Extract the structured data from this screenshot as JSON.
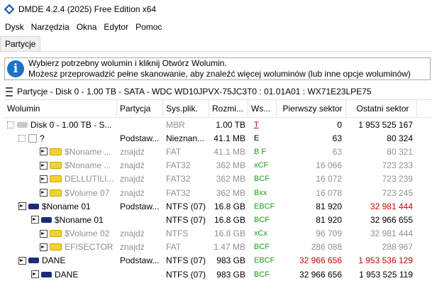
{
  "window": {
    "title": "DMDE 4.2.4 (2025) Free Edition x64"
  },
  "menu": [
    "Dysk",
    "Narzędzia",
    "Okna",
    "Edytor",
    "Pomoc"
  ],
  "tabs": [
    "Partycje"
  ],
  "info": {
    "line1": "Wybierz potrzebny wolumin i kliknij Otwórz Wolumin.",
    "line2": "Możesz przeprowadzić pełne skanowanie, aby znaleźć więcej woluminów (lub inne opcje woluminów)"
  },
  "panel": {
    "title": "Partycje - Disk 0 - 1.00 TB - SATA - WDC WD10JPVX-75JC3T0 : 01.01A01 : WX71E23LPE75"
  },
  "columns": [
    "Wolumin",
    "Partycja",
    "Sys.plik.",
    "Rozmi...",
    "Ws...",
    "Pierwszy sektor",
    "Ostatni sektor"
  ],
  "rows": [
    {
      "name": "Disk 0 - 1.00 TB - S...",
      "partition": "",
      "fs": "MBR",
      "size": "1.00 TB",
      "flags": "T",
      "first": "0",
      "last": "1 953 525 167"
    },
    {
      "name": "?",
      "partition": "Podstaw...",
      "fs": "Nieznan...",
      "size": "41.1 MB",
      "flags": "E",
      "first": "63",
      "last": "80 324"
    },
    {
      "name": "$Noname ...",
      "partition": "znajdź",
      "fs": "FAT",
      "size": "41.1 MB",
      "flags": "B F",
      "first": "63",
      "last": "80 321"
    },
    {
      "name": "$Noname ...",
      "partition": "znajdź",
      "fs": "FAT32",
      "size": "362 MB",
      "flags": "xCF",
      "first": "16 066",
      "last": "723 233"
    },
    {
      "name": "DELLUTILI...",
      "partition": "znajdź",
      "fs": "FAT32",
      "size": "362 MB",
      "flags": "BCF",
      "first": "16 072",
      "last": "723 239"
    },
    {
      "name": "$Volume 07",
      "partition": "znajdź",
      "fs": "FAT32",
      "size": "362 MB",
      "flags": "Bxx",
      "first": "16 078",
      "last": "723 245"
    },
    {
      "name": "$Noname 01",
      "partition": "Podstaw...",
      "fs": "NTFS (07)",
      "size": "16.8 GB",
      "flags": "EBCF",
      "first": "81 920",
      "last": "32 981 444"
    },
    {
      "name": "$Noname 01",
      "partition": "",
      "fs": "NTFS (07)",
      "size": "16.8 GB",
      "flags": "BCF",
      "first": "81 920",
      "last": "32 966 655"
    },
    {
      "name": "$Volume 02",
      "partition": "znajdź",
      "fs": "NTFS",
      "size": "16.8 GB",
      "flags": "xCx",
      "first": "96 709",
      "last": "32 981 444"
    },
    {
      "name": "EFISECTOR",
      "partition": "znajdź",
      "fs": "FAT",
      "size": "1.47 MB",
      "flags": "BCF",
      "first": "286 088",
      "last": "288 967"
    },
    {
      "name": "DANE",
      "partition": "Podstaw...",
      "fs": "NTFS (07)",
      "size": "983 GB",
      "flags": "EBCF",
      "first": "32 966 656",
      "last": "1 953 536 129"
    },
    {
      "name": "DANE",
      "partition": "",
      "fs": "NTFS (07)",
      "size": "983 GB",
      "flags": "BCF",
      "first": "32 966 656",
      "last": "1 953 525 119"
    }
  ]
}
